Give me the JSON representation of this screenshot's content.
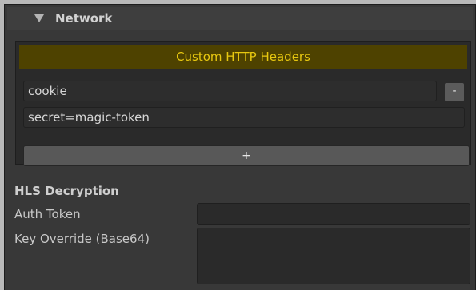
{
  "network": {
    "title": "Network",
    "custom_headers": {
      "banner": "Custom HTTP Headers",
      "entries": [
        {
          "name": "cookie",
          "value": "secret=magic-token"
        }
      ],
      "remove_label": "-",
      "add_label": "+"
    }
  },
  "hls": {
    "title": "HLS Decryption",
    "auth_token_label": "Auth Token",
    "auth_token_value": "",
    "key_override_label": "Key Override (Base64)",
    "key_override_value": ""
  },
  "colors": {
    "banner_bg": "#4e4200",
    "banner_text": "#e8c810",
    "panel_bg": "#383838"
  }
}
